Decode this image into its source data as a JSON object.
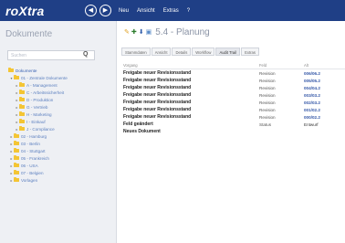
{
  "topbar": {
    "logo": "roXtra",
    "back_glyph": "◀",
    "forward_glyph": "▶",
    "menu": [
      "Neu",
      "Ansicht",
      "Extras",
      "?"
    ],
    "background": "#1f3f86"
  },
  "sidebar": {
    "title": "Dokumente",
    "search_placeholder": "Suchen",
    "search_icon": "Q",
    "tree": [
      {
        "label": "Dokumente",
        "arrow": "",
        "level": 0
      },
      {
        "label": "01 - Zentrale Dokumente",
        "arrow": "▾",
        "level": 1
      },
      {
        "label": "A - Management",
        "arrow": "▸",
        "level": 2
      },
      {
        "label": "C - Arbeitssicherheit",
        "arrow": "▸",
        "level": 2
      },
      {
        "label": "D - Produktion",
        "arrow": "▸",
        "level": 2
      },
      {
        "label": "G - Vertrieb",
        "arrow": "▸",
        "level": 2
      },
      {
        "label": "H - Marketing",
        "arrow": "▸",
        "level": 2
      },
      {
        "label": "I - Einkauf",
        "arrow": "▸",
        "level": 2
      },
      {
        "label": "J - Compliance",
        "arrow": "▸",
        "level": 2
      },
      {
        "label": "02 - Hamburg",
        "arrow": "▸",
        "level": 1
      },
      {
        "label": "03 - Berlin",
        "arrow": "▸",
        "level": 1
      },
      {
        "label": "04 - Stuttgart",
        "arrow": "▸",
        "level": 1
      },
      {
        "label": "05 - Frankreich",
        "arrow": "▸",
        "level": 1
      },
      {
        "label": "06 - USA",
        "arrow": "▸",
        "level": 1
      },
      {
        "label": "07 - Belgien",
        "arrow": "▸",
        "level": 1
      },
      {
        "label": "Vorlagen",
        "arrow": "▸",
        "level": 1
      }
    ]
  },
  "main": {
    "header_icons": [
      "✎",
      "✚",
      "⬇",
      "▣"
    ],
    "title": "5.4 - Planung",
    "tabs": [
      {
        "label": "Stammdaten"
      },
      {
        "label": "Ansicht"
      },
      {
        "label": "Details"
      },
      {
        "label": "Workflow"
      },
      {
        "label": "Audit Trail"
      },
      {
        "label": "Extras"
      }
    ],
    "columns": [
      "Vorgang",
      "Feld",
      "Alt"
    ],
    "rows": [
      {
        "vorgang": "Freigabe neuer Revisionsstand",
        "feld": "Revision",
        "alt": "006/06.2"
      },
      {
        "vorgang": "Freigabe neuer Revisionsstand",
        "feld": "Revision",
        "alt": "005/05.2"
      },
      {
        "vorgang": "Freigabe neuer Revisionsstand",
        "feld": "Revision",
        "alt": "004/04.2"
      },
      {
        "vorgang": "Freigabe neuer Revisionsstand",
        "feld": "Revision",
        "alt": "003/03.2"
      },
      {
        "vorgang": "Freigabe neuer Revisionsstand",
        "feld": "Revision",
        "alt": "002/03.2"
      },
      {
        "vorgang": "Freigabe neuer Revisionsstand",
        "feld": "Revision",
        "alt": "001/02.2"
      },
      {
        "vorgang": "Freigabe neuer Revisionsstand",
        "feld": "Revision",
        "alt": "000/02.2"
      },
      {
        "vorgang": "Feld geändert",
        "feld": "Status",
        "alt": "Entwurf"
      },
      {
        "vorgang": "Neues Dokument",
        "feld": "",
        "alt": ""
      }
    ]
  }
}
